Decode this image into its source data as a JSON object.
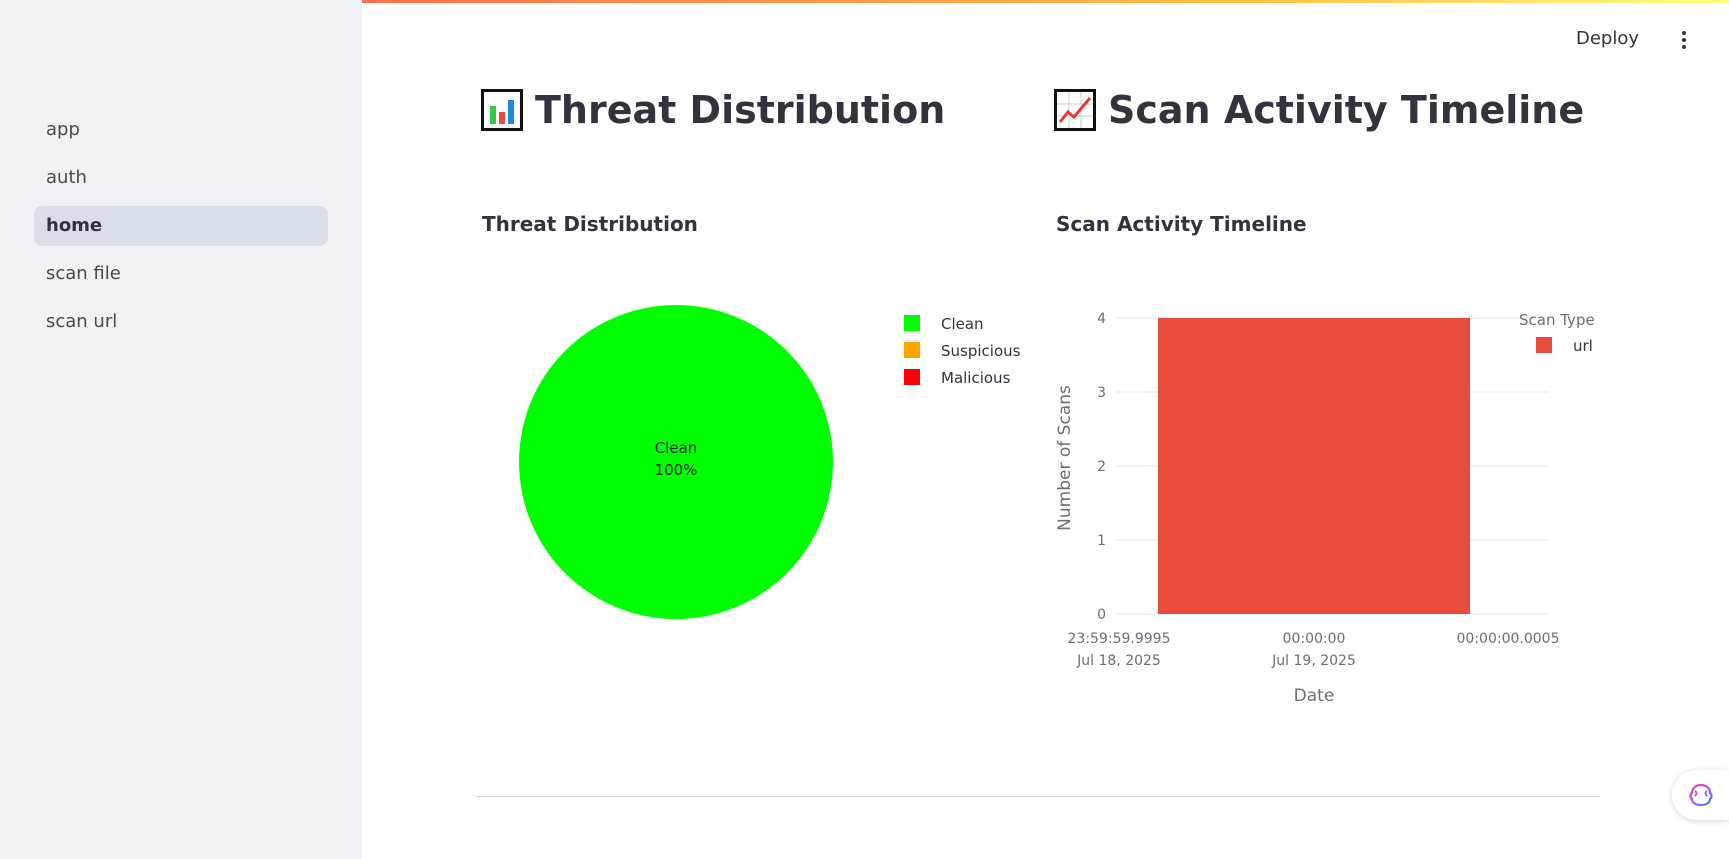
{
  "sidebar": {
    "items": [
      {
        "label": "app",
        "active": false
      },
      {
        "label": "auth",
        "active": false
      },
      {
        "label": "home",
        "active": true
      },
      {
        "label": "scan file",
        "active": false
      },
      {
        "label": "scan url",
        "active": false
      }
    ]
  },
  "header": {
    "deploy_label": "Deploy",
    "menu_icon": "kebab-menu-icon"
  },
  "sections": {
    "threat": {
      "heading": "Threat Distribution",
      "icon": "bar-chart-emoji-icon"
    },
    "timeline": {
      "heading": "Scan Activity Timeline",
      "icon": "chart-increasing-emoji-icon"
    }
  },
  "fab": {
    "icon": "brain-icon"
  },
  "chart_data": [
    {
      "type": "pie",
      "title": "Threat Distribution",
      "labels": [
        "Clean",
        "Suspicious",
        "Malicious"
      ],
      "values": [
        100,
        0,
        0
      ],
      "colors": [
        "#00ff00",
        "#ffa500",
        "#ff0000"
      ],
      "slice_label": {
        "name": "Clean",
        "percent": "100%"
      },
      "legend": "right"
    },
    {
      "type": "bar",
      "title": "Scan Activity Timeline",
      "xlabel": "Date",
      "ylabel": "Number of Scans",
      "legend_title": "Scan Type",
      "legend": "top-right",
      "grid": true,
      "ylim": [
        0,
        4
      ],
      "yticks": [
        0,
        1,
        2,
        3,
        4
      ],
      "xticks": [
        {
          "line1": "23:59:59.9995",
          "line2": "Jul 18, 2025"
        },
        {
          "line1": "00:00:00",
          "line2": "Jul 19, 2025"
        },
        {
          "line1": "00:00:00.0005",
          "line2": ""
        }
      ],
      "categories": [
        "Jul 19, 2025"
      ],
      "series": [
        {
          "name": "url",
          "color": "#e74c3c",
          "values": [
            4
          ]
        }
      ]
    }
  ]
}
